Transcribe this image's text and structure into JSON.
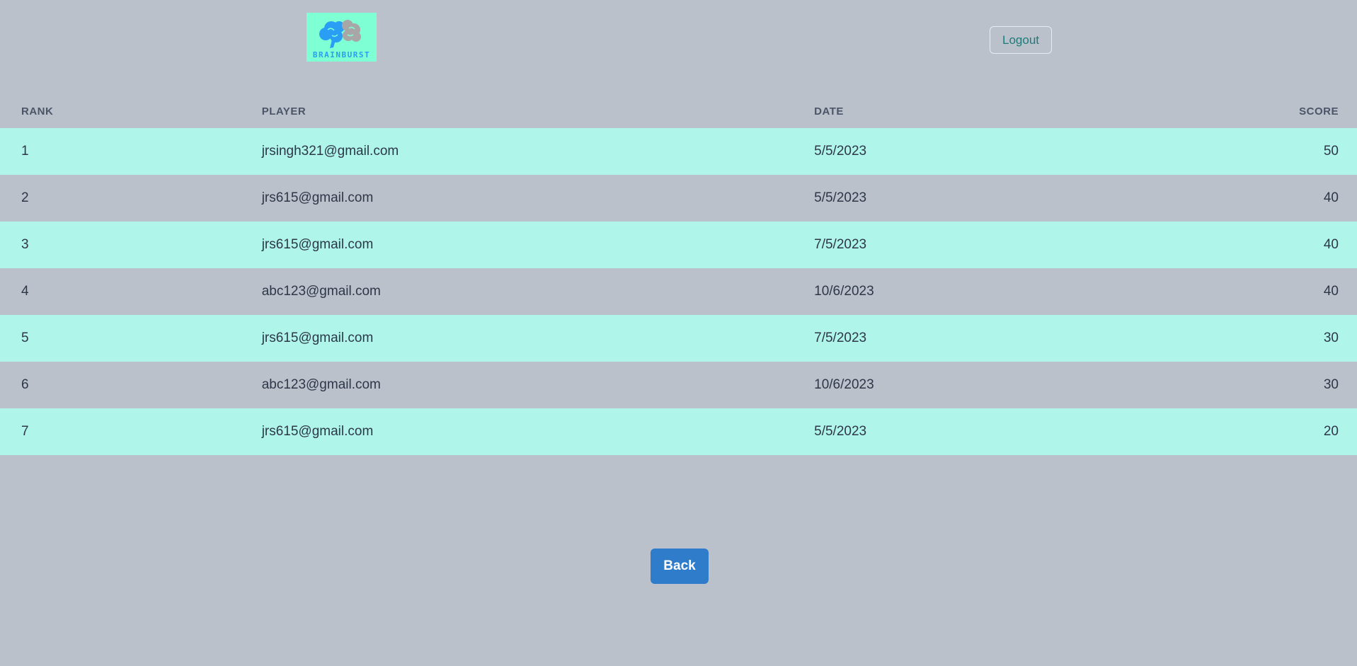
{
  "header": {
    "logo_text": "BRAINBURST",
    "logout_label": "Logout"
  },
  "table": {
    "columns": [
      "RANK",
      "PLAYER",
      "DATE",
      "SCORE"
    ],
    "rows": [
      {
        "rank": "1",
        "player": "jrsingh321@gmail.com",
        "date": "5/5/2023",
        "score": "50"
      },
      {
        "rank": "2",
        "player": "jrs615@gmail.com",
        "date": "5/5/2023",
        "score": "40"
      },
      {
        "rank": "3",
        "player": "jrs615@gmail.com",
        "date": "7/5/2023",
        "score": "40"
      },
      {
        "rank": "4",
        "player": "abc123@gmail.com",
        "date": "10/6/2023",
        "score": "40"
      },
      {
        "rank": "5",
        "player": "jrs615@gmail.com",
        "date": "7/5/2023",
        "score": "30"
      },
      {
        "rank": "6",
        "player": "abc123@gmail.com",
        "date": "10/6/2023",
        "score": "30"
      },
      {
        "rank": "7",
        "player": "jrs615@gmail.com",
        "date": "5/5/2023",
        "score": "20"
      }
    ]
  },
  "footer": {
    "back_label": "Back"
  },
  "colors": {
    "background": "#bac1cb",
    "row_highlight": "#b0f5ea",
    "logo_background": "#7fffd4",
    "back_button": "#2f7dca",
    "logout_text": "#1f7a7a"
  },
  "icons": {
    "logo": "brain-icon"
  }
}
